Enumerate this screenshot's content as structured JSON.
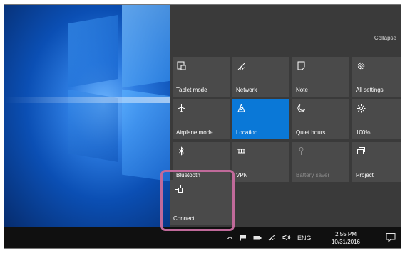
{
  "action_center": {
    "collapse_label": "Collapse",
    "tiles": [
      {
        "label": "Tablet mode",
        "icon": "tablet-mode-icon",
        "state": "off"
      },
      {
        "label": "Network",
        "icon": "network-icon",
        "state": "off"
      },
      {
        "label": "Note",
        "icon": "note-icon",
        "state": "off"
      },
      {
        "label": "All settings",
        "icon": "gear-icon",
        "state": "off"
      },
      {
        "label": "Airplane mode",
        "icon": "airplane-icon",
        "state": "off"
      },
      {
        "label": "Location",
        "icon": "location-icon",
        "state": "on"
      },
      {
        "label": "Quiet hours",
        "icon": "moon-icon",
        "state": "off"
      },
      {
        "label": "100%",
        "icon": "brightness-icon",
        "state": "off"
      },
      {
        "label": "Bluetooth",
        "icon": "bluetooth-icon",
        "state": "off"
      },
      {
        "label": "VPN",
        "icon": "vpn-icon",
        "state": "off"
      },
      {
        "label": "Battery saver",
        "icon": "battery-saver-icon",
        "state": "disabled"
      },
      {
        "label": "Project",
        "icon": "project-icon",
        "state": "off"
      },
      {
        "label": "Connect",
        "icon": "connect-icon",
        "state": "off"
      }
    ]
  },
  "taskbar": {
    "language": "ENG",
    "time": "2:55 PM",
    "date": "10/31/2016"
  },
  "colors": {
    "accent": "#0a78d7",
    "tile": "#4a4a4a",
    "panel": "#3a3a3a",
    "highlight": "#c06a9a"
  }
}
